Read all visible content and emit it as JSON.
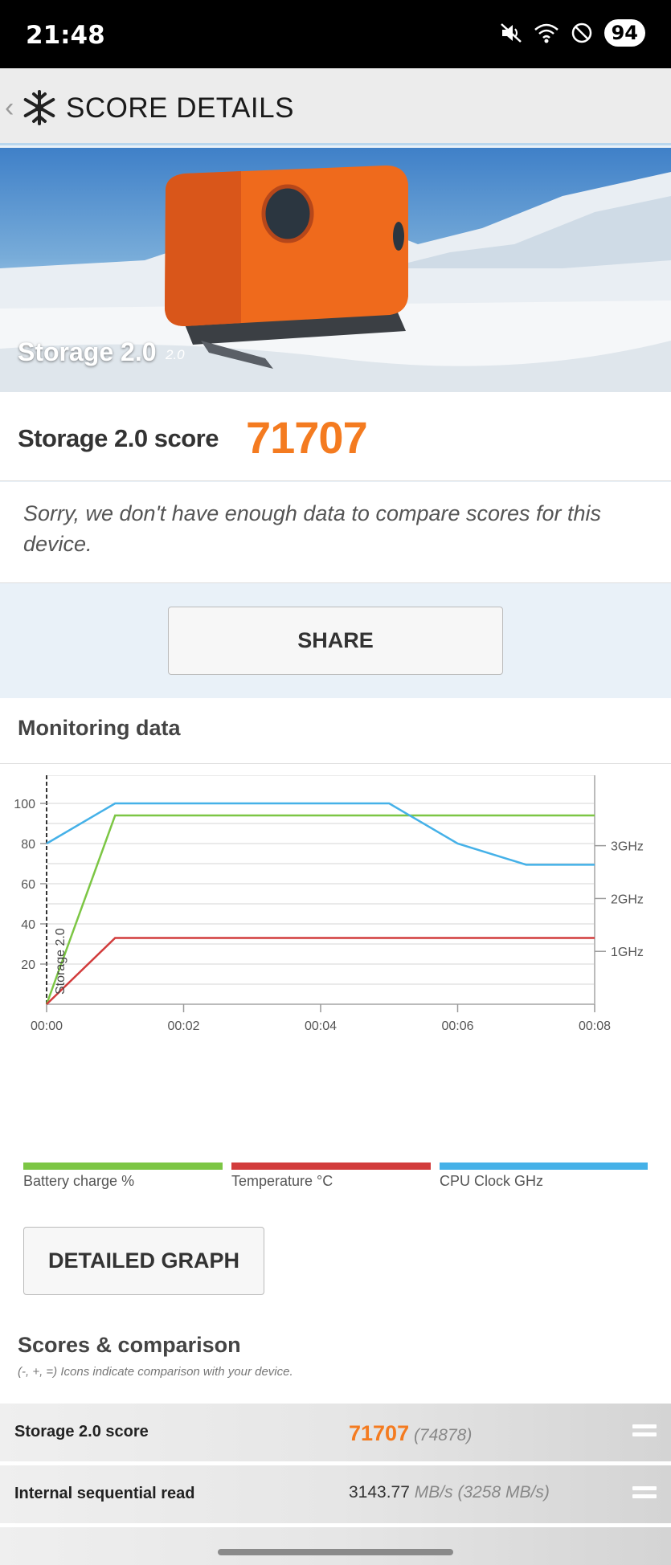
{
  "status_bar": {
    "time": "21:48",
    "battery": "94",
    "icons": [
      "mute-icon",
      "wifi-icon",
      "do-not-disturb-icon"
    ]
  },
  "app_bar": {
    "back_glyph": "‹",
    "title": "SCORE DETAILS",
    "logo": "snowflake-icon"
  },
  "hero": {
    "title": "Storage 2.0",
    "version": "2.0"
  },
  "score": {
    "label": "Storage 2.0 score",
    "value": "71707",
    "color": "#f47b20"
  },
  "compare_note": "Sorry, we don't have enough data to compare scores for this device.",
  "share_label": "SHARE",
  "monitoring": {
    "title": "Monitoring data",
    "detailed_graph_label": "DETAILED GRAPH",
    "legend": [
      {
        "label": "Battery charge %",
        "color": "#7cc644"
      },
      {
        "label": "Temperature °C",
        "color": "#d23c3c"
      },
      {
        "label": "CPU Clock GHz",
        "color": "#45b1e8"
      }
    ]
  },
  "chart_data": {
    "type": "line",
    "x_tick_labels": [
      "00:00",
      "00:02",
      "00:04",
      "00:06",
      "00:08"
    ],
    "x_range_minutes": [
      0,
      8
    ],
    "y_left_ticks": [
      20,
      40,
      60,
      80,
      100
    ],
    "y_left_range": [
      0,
      100
    ],
    "y_right_ticks": [
      "1GHz",
      "2GHz",
      "3GHz"
    ],
    "y_right_range_ghz": [
      0,
      3.8
    ],
    "marker_label": "Storage 2.0",
    "grid": true,
    "series": [
      {
        "name": "Battery charge %",
        "axis": "left",
        "color": "#7cc644",
        "x_minutes": [
          0,
          1,
          8
        ],
        "values": [
          0,
          94,
          94
        ]
      },
      {
        "name": "Temperature °C",
        "axis": "left",
        "color": "#d23c3c",
        "x_minutes": [
          0,
          1,
          8
        ],
        "values": [
          0,
          33,
          33
        ]
      },
      {
        "name": "CPU Clock GHz",
        "axis": "right",
        "color": "#45b1e8",
        "x_minutes": [
          0,
          1,
          5,
          6,
          7,
          8
        ],
        "values": [
          3.04,
          3.8,
          3.8,
          3.04,
          2.64,
          2.64
        ]
      }
    ]
  },
  "scores_comparison": {
    "title": "Scores & comparison",
    "subtitle": "(-, +, =) Icons indicate comparison with your device.",
    "rows": [
      {
        "label": "Storage 2.0 score",
        "value": "71707",
        "reference": "(74878)"
      },
      {
        "label": "Internal sequential read",
        "value": "3143.77",
        "unit": "MB/s",
        "reference": "(3258 MB/s)"
      }
    ]
  }
}
